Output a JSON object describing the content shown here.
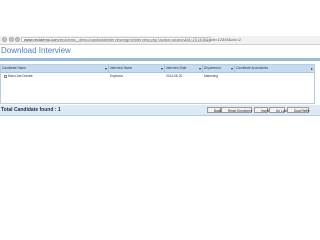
{
  "browser": {
    "url_host": "www.recidemo.com",
    "url_path": "/recidemo_demo/candidateinterviewmgmt/interview.php?action=search&id=201406&sort=12345&cid=2"
  },
  "page": {
    "title": "Download Interview"
  },
  "grid": {
    "columns": [
      "Candidate Name",
      "Interview Name",
      "Interview Date",
      "Department",
      "Candidate Accessibles"
    ],
    "rows": [
      {
        "candidate_name": "Mono Ate Donate",
        "interview_name": "Euphoria",
        "interview_date": "2014-06-20",
        "department": "Marketing",
        "accessibles": ""
      }
    ]
  },
  "footer": {
    "total_label": "Total Candidate found : 1",
    "buttons": [
      "Back",
      "Reset Enrolment",
      "Invert",
      "Un Lock",
      "Dual Refile"
    ]
  },
  "colors": {
    "header_bg": "#c7dbee",
    "title_color": "#4f82b8",
    "footer_bg": "#dde9f5"
  }
}
